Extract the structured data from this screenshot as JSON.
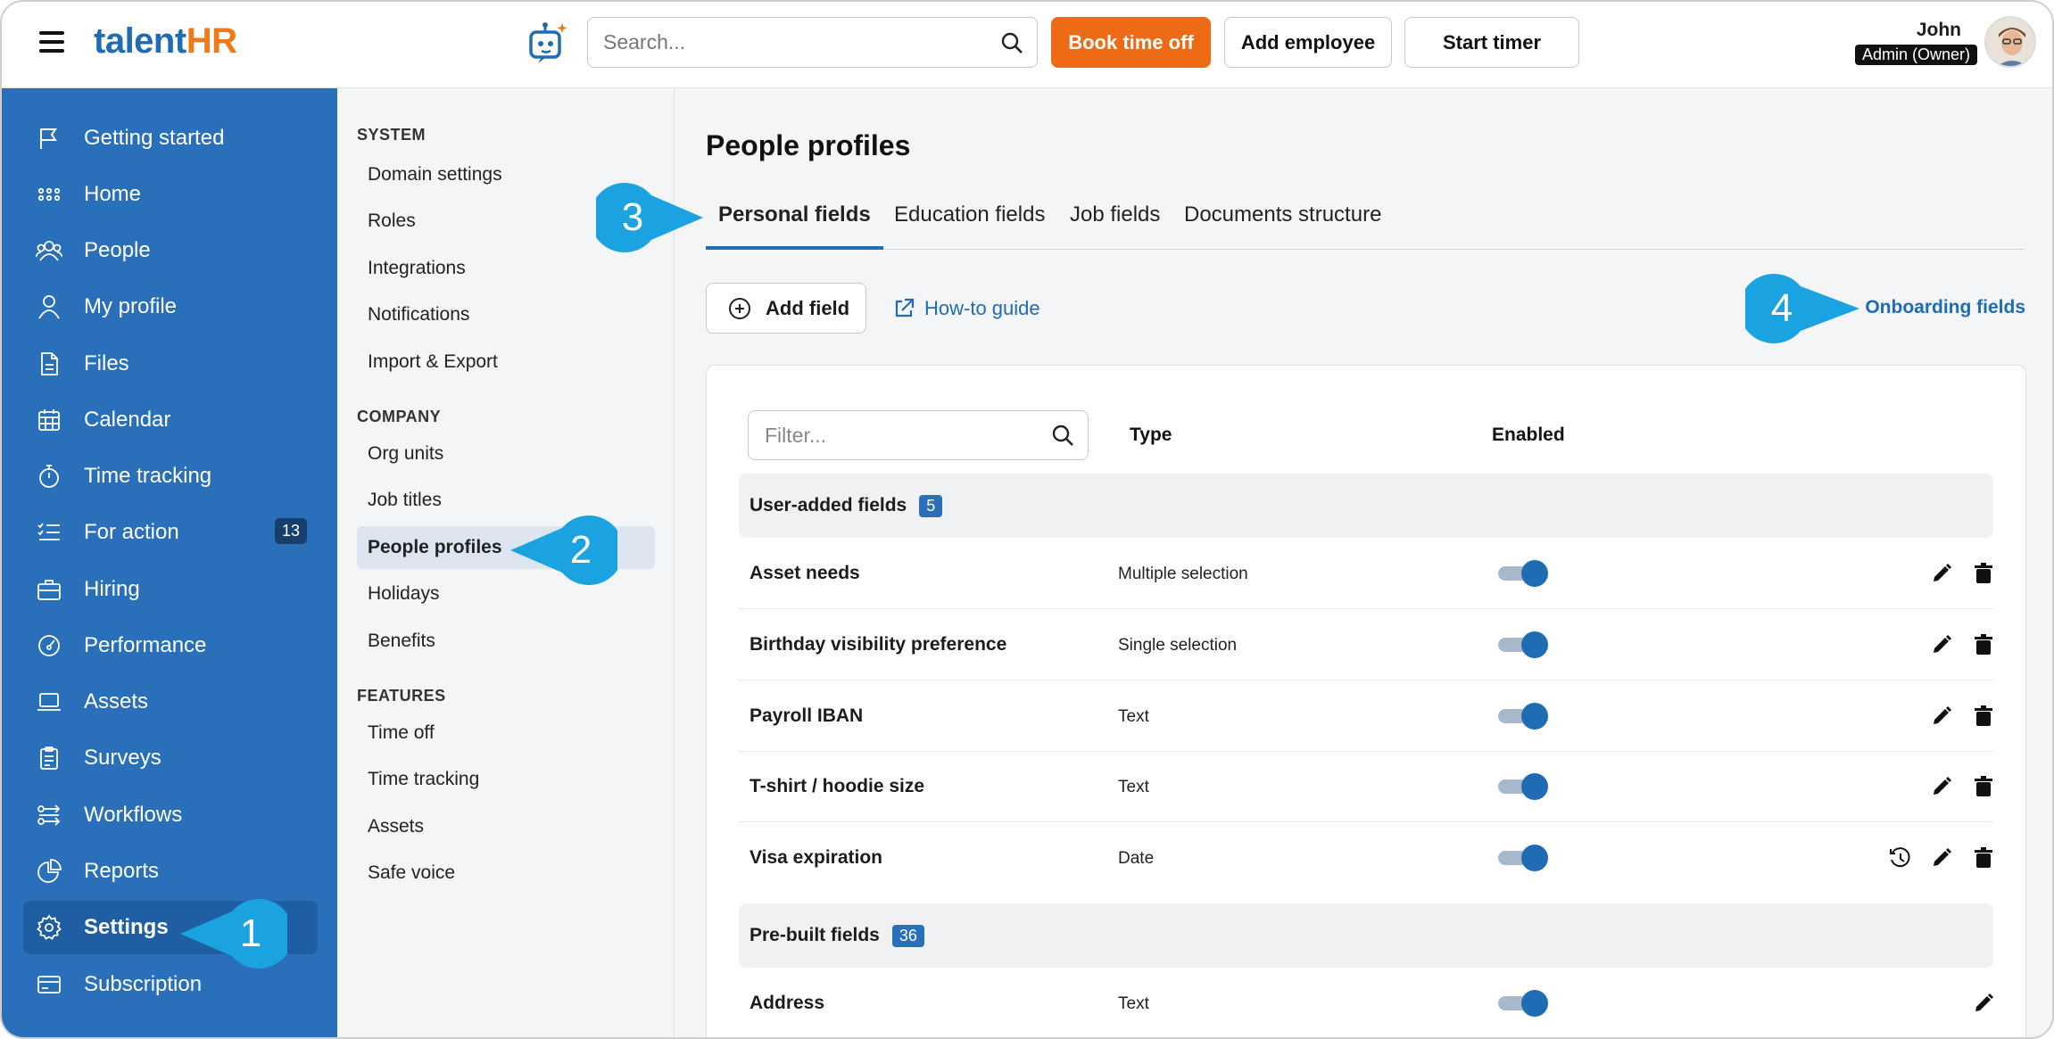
{
  "topbar": {
    "logo_part1": "talent",
    "logo_part2": "HR",
    "search_placeholder": "Search...",
    "book_time_off": "Book time off",
    "add_employee": "Add employee",
    "start_timer": "Start timer",
    "user_name": "John",
    "user_role": "Admin (Owner)"
  },
  "sidebar": {
    "items": [
      {
        "label": "Getting started",
        "icon": "flag-icon"
      },
      {
        "label": "Home",
        "icon": "grid-icon"
      },
      {
        "label": "People",
        "icon": "people-icon"
      },
      {
        "label": "My profile",
        "icon": "user-icon"
      },
      {
        "label": "Files",
        "icon": "file-icon"
      },
      {
        "label": "Calendar",
        "icon": "calendar-icon"
      },
      {
        "label": "Time tracking",
        "icon": "stopwatch-icon"
      },
      {
        "label": "For action",
        "icon": "checklist-icon",
        "badge": "13"
      },
      {
        "label": "Hiring",
        "icon": "briefcase-icon"
      },
      {
        "label": "Performance",
        "icon": "gauge-icon"
      },
      {
        "label": "Assets",
        "icon": "laptop-icon"
      },
      {
        "label": "Surveys",
        "icon": "clipboard-icon"
      },
      {
        "label": "Workflows",
        "icon": "workflow-icon"
      },
      {
        "label": "Reports",
        "icon": "pie-chart-icon"
      },
      {
        "label": "Settings",
        "icon": "gear-icon",
        "active": true
      },
      {
        "label": "Subscription",
        "icon": "credit-card-icon"
      }
    ]
  },
  "subnav": {
    "system_heading": "SYSTEM",
    "system_items": [
      "Domain settings",
      "Roles",
      "Integrations",
      "Notifications",
      "Import & Export"
    ],
    "company_heading": "COMPANY",
    "company_items": [
      "Org units",
      "Job titles",
      "People profiles",
      "Holidays",
      "Benefits"
    ],
    "features_heading": "FEATURES",
    "features_items": [
      "Time off",
      "Time tracking",
      "Assets",
      "Safe voice"
    ]
  },
  "main": {
    "title": "People profiles",
    "tabs": [
      "Personal fields",
      "Education fields",
      "Job fields",
      "Documents structure"
    ],
    "add_field": "Add field",
    "howto": "How-to guide",
    "onboarding": "Onboarding fields",
    "filter_placeholder": "Filter...",
    "col_type": "Type",
    "col_enabled": "Enabled",
    "group1": {
      "label": "User-added fields",
      "count": "5"
    },
    "rows1": [
      {
        "name": "Asset needs",
        "type": "Multiple selection",
        "enabled": true
      },
      {
        "name": "Birthday visibility preference",
        "type": "Single selection",
        "enabled": true
      },
      {
        "name": "Payroll IBAN",
        "type": "Text",
        "enabled": true
      },
      {
        "name": "T-shirt / hoodie size",
        "type": "Text",
        "enabled": true
      },
      {
        "name": "Visa expiration",
        "type": "Date",
        "enabled": true
      }
    ],
    "group2": {
      "label": "Pre-built fields",
      "count": "36"
    },
    "rows2": [
      {
        "name": "Address",
        "type": "Text",
        "enabled": true
      }
    ]
  },
  "callouts": [
    "1",
    "2",
    "3",
    "4"
  ],
  "colors": {
    "sidebar": "#2a6fba",
    "accent": "#1f6cb4",
    "orange": "#ef6a15",
    "callout": "#1aa3e0"
  }
}
